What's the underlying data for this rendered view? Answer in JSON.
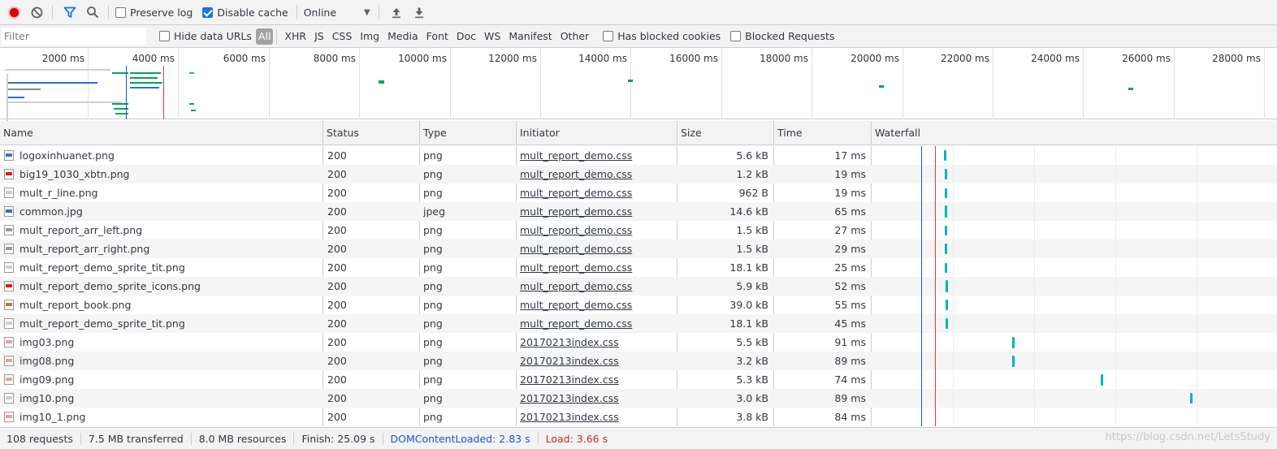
{
  "toolbar": {
    "record": "record-icon",
    "clear": "clear-icon",
    "filter": "filter-icon",
    "search": "search-icon",
    "preserve_log_label": "Preserve log",
    "preserve_log_checked": false,
    "disable_cache_label": "Disable cache",
    "disable_cache_checked": true,
    "throttle_value": "Online",
    "import": "upload-icon",
    "export": "download-icon"
  },
  "filterbar": {
    "placeholder": "Filter",
    "hide_data_urls_label": "Hide data URLs",
    "types": [
      "All",
      "XHR",
      "JS",
      "CSS",
      "Img",
      "Media",
      "Font",
      "Doc",
      "WS",
      "Manifest",
      "Other"
    ],
    "active_type": "All",
    "blocked_cookies_label": "Has blocked cookies",
    "blocked_requests_label": "Blocked Requests"
  },
  "overview": {
    "ticks": [
      "2000 ms",
      "4000 ms",
      "6000 ms",
      "8000 ms",
      "10000 ms",
      "12000 ms",
      "14000 ms",
      "16000 ms",
      "18000 ms",
      "20000 ms",
      "22000 ms",
      "24000 ms",
      "26000 ms",
      "28000 ms"
    ]
  },
  "table": {
    "headers": {
      "name": "Name",
      "status": "Status",
      "type": "Type",
      "initiator": "Initiator",
      "size": "Size",
      "time": "Time",
      "waterfall": "Waterfall"
    },
    "rows": [
      {
        "name": "logoxinhuanet.png",
        "status": "200",
        "type": "png",
        "initiator": "mult_report_demo.css",
        "size": "5.6 kB",
        "time": "17 ms"
      },
      {
        "name": "big19_1030_xbtn.png",
        "status": "200",
        "type": "png",
        "initiator": "mult_report_demo.css",
        "size": "1.2 kB",
        "time": "19 ms"
      },
      {
        "name": "mult_r_line.png",
        "status": "200",
        "type": "png",
        "initiator": "mult_report_demo.css",
        "size": "962 B",
        "time": "19 ms"
      },
      {
        "name": "common.jpg",
        "status": "200",
        "type": "jpeg",
        "initiator": "mult_report_demo.css",
        "size": "14.6 kB",
        "time": "65 ms"
      },
      {
        "name": "mult_report_arr_left.png",
        "status": "200",
        "type": "png",
        "initiator": "mult_report_demo.css",
        "size": "1.5 kB",
        "time": "27 ms"
      },
      {
        "name": "mult_report_arr_right.png",
        "status": "200",
        "type": "png",
        "initiator": "mult_report_demo.css",
        "size": "1.5 kB",
        "time": "29 ms"
      },
      {
        "name": "mult_report_demo_sprite_tit.png",
        "status": "200",
        "type": "png",
        "initiator": "mult_report_demo.css",
        "size": "18.1 kB",
        "time": "25 ms"
      },
      {
        "name": "mult_report_demo_sprite_icons.png",
        "status": "200",
        "type": "png",
        "initiator": "mult_report_demo.css",
        "size": "5.9 kB",
        "time": "52 ms"
      },
      {
        "name": "mult_report_book.png",
        "status": "200",
        "type": "png",
        "initiator": "mult_report_demo.css",
        "size": "39.0 kB",
        "time": "55 ms"
      },
      {
        "name": "mult_report_demo_sprite_tit.png",
        "status": "200",
        "type": "png",
        "initiator": "mult_report_demo.css",
        "size": "18.1 kB",
        "time": "45 ms"
      },
      {
        "name": "img03.png",
        "status": "200",
        "type": "png",
        "initiator": "20170213index.css",
        "size": "5.5 kB",
        "time": "91 ms"
      },
      {
        "name": "img08.png",
        "status": "200",
        "type": "png",
        "initiator": "20170213index.css",
        "size": "3.2 kB",
        "time": "89 ms"
      },
      {
        "name": "img09.png",
        "status": "200",
        "type": "png",
        "initiator": "20170213index.css",
        "size": "5.3 kB",
        "time": "74 ms"
      },
      {
        "name": "img10.png",
        "status": "200",
        "type": "png",
        "initiator": "20170213index.css",
        "size": "3.0 kB",
        "time": "89 ms"
      },
      {
        "name": "img10_1.png",
        "status": "200",
        "type": "png",
        "initiator": "20170213index.css",
        "size": "3.8 kB",
        "time": "84 ms"
      }
    ]
  },
  "statusbar": {
    "requests": "108 requests",
    "transferred": "7.5 MB transferred",
    "resources": "8.0 MB resources",
    "finish": "Finish: 25.09 s",
    "dom_content_loaded": "DOMContentLoaded: 2.83 s",
    "load": "Load: 3.66 s"
  },
  "watermark": "https://blog.csdn.net/LetsStudy",
  "colors": {
    "dom_line": "#1a53d4",
    "load_line": "#e03e3e",
    "bar": "#00b5b5",
    "record": "#e10000"
  }
}
